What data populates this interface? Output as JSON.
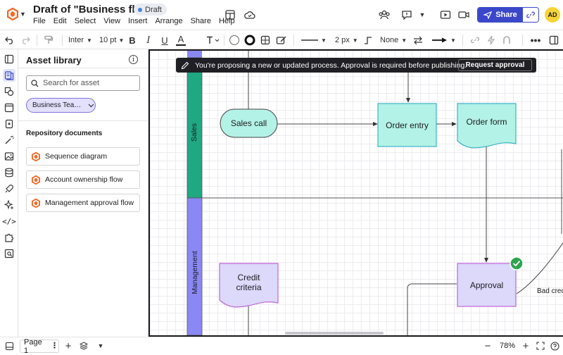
{
  "header": {
    "title": "Draft of \"Business flow\"",
    "status_badge": "Draft",
    "menu": [
      "File",
      "Edit",
      "Select",
      "View",
      "Insert",
      "Arrange",
      "Share",
      "Help"
    ],
    "share_label": "Share",
    "avatar_initials": "AD"
  },
  "toolbar": {
    "font_name": "Inter",
    "font_size": "10 pt",
    "bold": "B",
    "italic": "I",
    "underline": "U",
    "text_color": "A",
    "line_width": "2 px",
    "endpoint": "None"
  },
  "asset_panel": {
    "title": "Asset library",
    "search_placeholder": "Search for asset",
    "team_filter": "Business Tea…",
    "section_title": "Repository documents",
    "documents": [
      "Sequence diagram",
      "Account ownership flow",
      "Management approval flow"
    ]
  },
  "banner": {
    "message": "You're proposing a new or updated process. Approval is required before publishing.",
    "action_label": "Request approval"
  },
  "diagram": {
    "lanes": [
      "Sales",
      "Management"
    ],
    "shapes": {
      "sales_call": "Sales call",
      "order_entry": "Order entry",
      "order_form": "Order form",
      "credit_criteria_1": "Credit",
      "credit_criteria_2": "criteria",
      "approval": "Approval",
      "bad_credit": "Bad cred"
    },
    "colors": {
      "sales_lane": "#1fa882",
      "management_lane": "#8a88f5",
      "teal_shape": "#b3f2e7",
      "teal_border": "#3cb3c6",
      "purple_shape": "#dcd9fb",
      "purple_border": "#c264d8",
      "check": "#2ea44f"
    }
  },
  "bottom": {
    "page_label": "Page 1",
    "zoom": "78%"
  }
}
